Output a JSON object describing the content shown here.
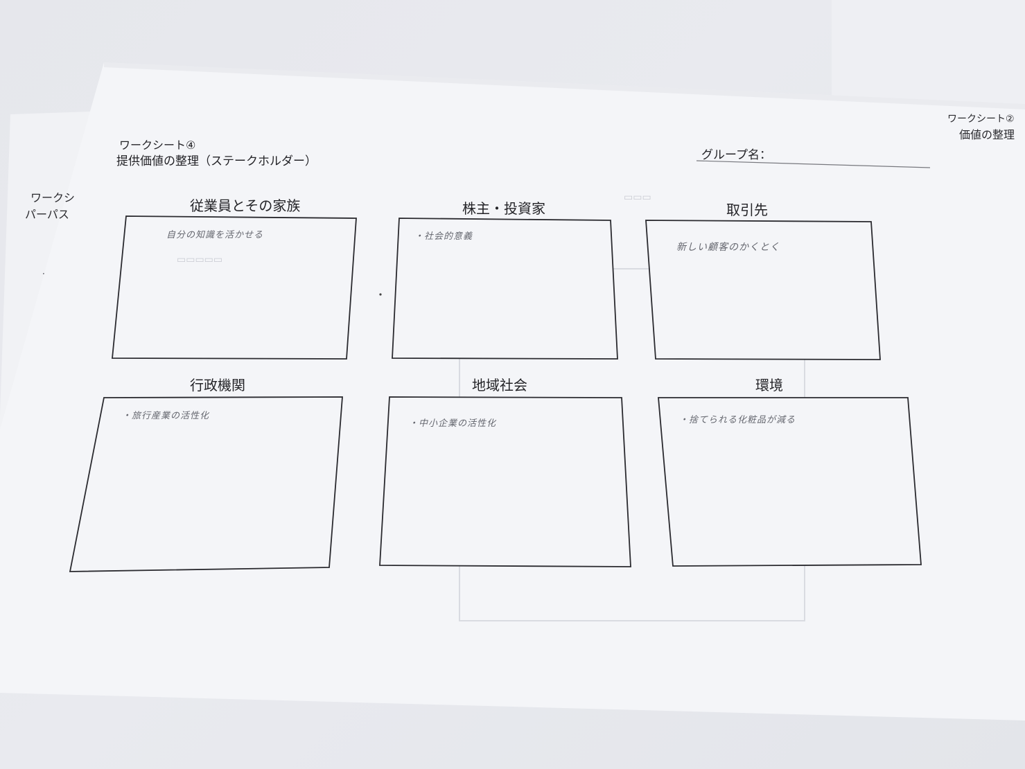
{
  "worksheet": {
    "sheet_number": "ワークシート④",
    "title": "提供価値の整理（ステークホルダー）",
    "group_label": "グループ名："
  },
  "stakeholders": [
    {
      "name": "従業員とその家族",
      "note": "自分の知識を活かせる"
    },
    {
      "name": "株主・投資家",
      "note": "・社会的意義"
    },
    {
      "name": "取引先",
      "note": "新しい顧客のかくとく"
    },
    {
      "name": "行政機関",
      "note": "・旅行産業の活性化"
    },
    {
      "name": "地域社会",
      "note": "・中小企業の活性化"
    },
    {
      "name": "環境",
      "note": "・捨てられる化粧品が減る"
    }
  ],
  "left_sheet": {
    "line1": "ワークシ",
    "line2": "パーパス"
  },
  "right_sheet": {
    "line1": "ワークシート②",
    "line2": "価値の整理"
  }
}
